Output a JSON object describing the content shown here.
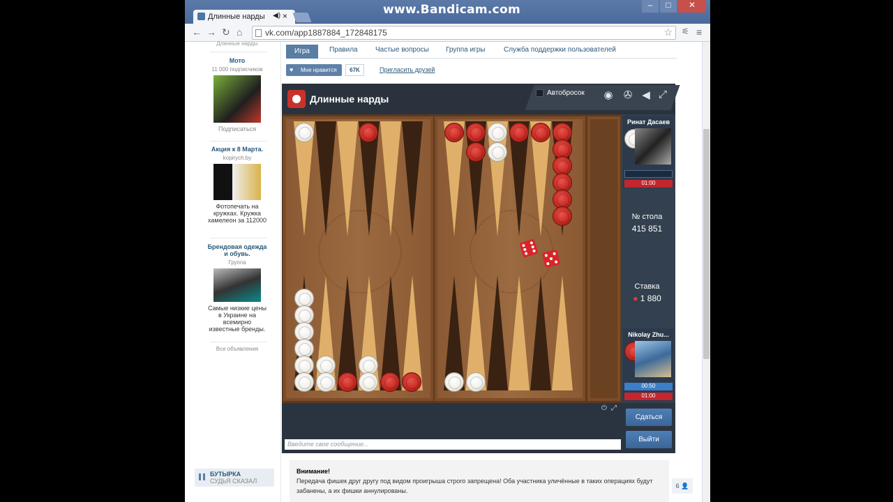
{
  "browser": {
    "tab_title": "Длинные нарды",
    "url": "vk.com/app1887884_172848175",
    "watermark": "www.Bandicam.com"
  },
  "sidebar": {
    "cut_text": "Длинные нарды",
    "ads": [
      {
        "title": "Мото",
        "sub": "11 000 подписчиков",
        "text": "Подписаться"
      },
      {
        "title": "Акция к 8 Марта.",
        "sub": "kopirych.by",
        "text": "Фотопечать на кружках. Кружка хамелеон за 112000"
      },
      {
        "title": "Брендовая одежда и обувь.",
        "sub": "Группа",
        "text": "Самые низкие цены в Украине на всемирно известные бренды."
      }
    ],
    "all_ads": "Все объявления",
    "music": {
      "artist": "БУТЫРКА",
      "song": "СУДЬЯ СКАЗАЛ"
    }
  },
  "app_tabs": [
    "Игра",
    "Правила",
    "Частые вопросы",
    "Группа игры",
    "Служба поддержки пользователей"
  ],
  "like": {
    "label": "Мне нравится",
    "count": "67K",
    "invite": "Пригласить друзей"
  },
  "game": {
    "title": "Длинные нарды",
    "autoroll": "Автобросок",
    "player1": {
      "name": "Ринат Дасаев",
      "timer": "01:00"
    },
    "player2": {
      "name": "Nikolay Zhu...",
      "timer1": "00:50",
      "timer2": "01:00"
    },
    "table_label": "№ стола",
    "table_number": "415 851",
    "stake_label": "Ставка",
    "stake_value": "1 880",
    "btn_surrender": "Сдаться",
    "btn_exit": "Выйти",
    "chat_placeholder": "Введите свое сообщение..."
  },
  "notice": {
    "title": "Внимание!",
    "text": "Передача фишек друг другу под видом проигрыша строго запрещена! Оба участника уличённые в таких операциях будут забанены, а их фишки аннулированы."
  },
  "online_count": "6"
}
